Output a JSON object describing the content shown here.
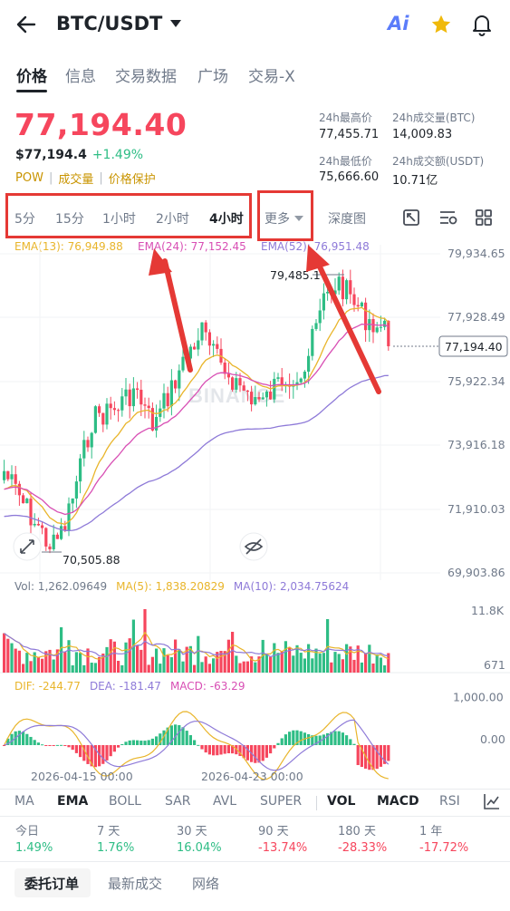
{
  "header": {
    "pair": "BTC/USDT",
    "ai_label": "Ai"
  },
  "tabs": [
    {
      "label": "价格",
      "active": true
    },
    {
      "label": "信息",
      "active": false
    },
    {
      "label": "交易数据",
      "active": false
    },
    {
      "label": "广场",
      "active": false
    },
    {
      "label": "交易-X",
      "active": false
    }
  ],
  "price": {
    "last": "77,194.40",
    "usd": "$77,194.4",
    "change": "+1.49%",
    "tags": [
      "POW",
      "成交量",
      "价格保护"
    ]
  },
  "stats": {
    "high_label": "24h最高价",
    "high": "77,455.71",
    "vol_btc_label": "24h成交量(BTC)",
    "vol_btc": "14,009.83",
    "low_label": "24h最低价",
    "low": "75,666.60",
    "vol_usdt_label": "24h成交额(USDT)",
    "vol_usdt": "10.71亿"
  },
  "intervals": [
    "5分",
    "15分",
    "1小时",
    "2小时",
    "4小时"
  ],
  "more_label": "更多",
  "depth_label": "深度图",
  "ema": {
    "e13": "EMA(13): 76,949.88",
    "e24": "EMA(24): 77,152.45",
    "e52": "EMA(52): 76,951.48"
  },
  "axis": {
    "y": [
      "79,934.65",
      "77,928.49",
      "75,922.34",
      "73,916.18",
      "71,910.03",
      "69,903.86"
    ],
    "current": "77,194.40",
    "high_mark": "79,485.1",
    "low_mark": "70,505.88",
    "dates": [
      "2026-04-15 00:00",
      "2026-04-23 00:00"
    ]
  },
  "watermark": "BINANCE",
  "volume": {
    "vol": "Vol: 1,262.09649",
    "ma5": "MA(5): 1,838.20829",
    "ma10": "MA(10): 2,034.75624",
    "y_top": "11.8K",
    "y_bot": "671"
  },
  "macd": {
    "dif": "DIF: -244.77",
    "dea": "DEA: -181.47",
    "macd": "MACD: -63.29",
    "y_top": "1,000.00",
    "y_zero": "0.00"
  },
  "indicators": [
    "MA",
    "EMA",
    "BOLL",
    "SAR",
    "AVL",
    "SUPER",
    "VOL",
    "MACD",
    "RSI"
  ],
  "performance": [
    {
      "label": "今日",
      "value": "1.49%",
      "dir": "up"
    },
    {
      "label": "7 天",
      "value": "1.76%",
      "dir": "up"
    },
    {
      "label": "30 天",
      "value": "16.04%",
      "dir": "up"
    },
    {
      "label": "90 天",
      "value": "-13.74%",
      "dir": "down"
    },
    {
      "label": "180 天",
      "value": "-28.33%",
      "dir": "down"
    },
    {
      "label": "1 年",
      "value": "-17.72%",
      "dir": "down"
    }
  ],
  "bottom_tabs": [
    "委托订单",
    "最新成交",
    "网络"
  ],
  "colors": {
    "up": "#2ebd85",
    "down": "#f6465d",
    "brand": "#f0b90b",
    "price_red": "#f6465d",
    "ema13": "#e9b52b",
    "ema24": "#d84fb4",
    "ema52": "#8e7ad8",
    "highlight_box": "#e53935"
  }
}
